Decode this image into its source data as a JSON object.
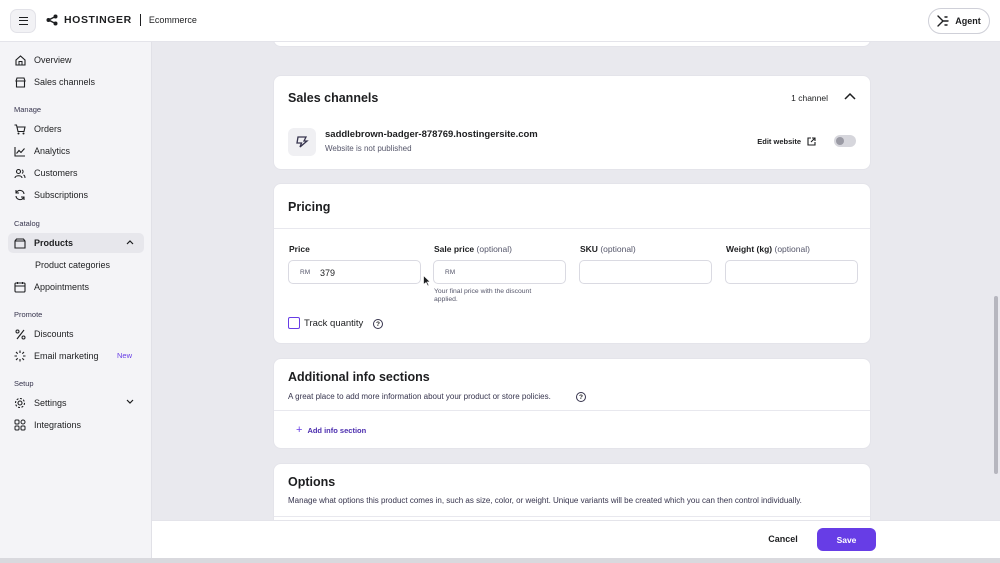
{
  "header": {
    "brand": "HOSTINGER",
    "product": "Ecommerce",
    "agent_label": "Agent"
  },
  "sidebar": {
    "items_top": [
      {
        "label": "Overview",
        "icon": "home-icon"
      },
      {
        "label": "Sales channels",
        "icon": "store-icon"
      }
    ],
    "sections": {
      "manage": "Manage",
      "catalog": "Catalog",
      "promote": "Promote",
      "setup": "Setup"
    },
    "manage_items": [
      {
        "label": "Orders",
        "icon": "cart-icon"
      },
      {
        "label": "Analytics",
        "icon": "chart-icon"
      },
      {
        "label": "Customers",
        "icon": "users-icon"
      },
      {
        "label": "Subscriptions",
        "icon": "refresh-icon"
      }
    ],
    "catalog_items": [
      {
        "label": "Products",
        "icon": "tag-icon"
      },
      {
        "label": "Product categories"
      },
      {
        "label": "Appointments",
        "icon": "calendar-icon"
      }
    ],
    "promote_items": [
      {
        "label": "Discounts",
        "icon": "percent-icon"
      },
      {
        "label": "Email marketing",
        "icon": "sparkle-icon",
        "badge": "New"
      }
    ],
    "setup_items": [
      {
        "label": "Settings",
        "icon": "gear-icon"
      },
      {
        "label": "Integrations",
        "icon": "grid-icon"
      }
    ]
  },
  "sales_channels": {
    "title": "Sales channels",
    "count": "1 channel",
    "site_name": "saddlebrown-badger-878769.hostingersite.com",
    "site_status": "Website is not published",
    "edit_label": "Edit website",
    "published": false
  },
  "pricing": {
    "title": "Pricing",
    "price": {
      "label": "Price",
      "prefix": "RM",
      "value": "379"
    },
    "sale_price": {
      "label": "Sale price",
      "optional": "(optional)",
      "prefix": "RM",
      "value": "",
      "hint": "Your final price with the discount applied."
    },
    "sku": {
      "label": "SKU",
      "optional": "(optional)",
      "value": ""
    },
    "weight": {
      "label": "Weight (kg)",
      "optional": "(optional)",
      "value": ""
    },
    "track_quantity": "Track quantity",
    "track_checked": false
  },
  "additional_info": {
    "title": "Additional info sections",
    "description": "A great place to add more information about your product or store policies.",
    "add_label": "Add info section"
  },
  "options": {
    "title": "Options",
    "description": "Manage what options this product comes in, such as size, color, or weight. Unique variants will be created which you can then control individually."
  },
  "footer": {
    "cancel_label": "Cancel",
    "save_label": "Save"
  },
  "colors": {
    "accent": "#673de6",
    "text": "#1d1e20"
  }
}
